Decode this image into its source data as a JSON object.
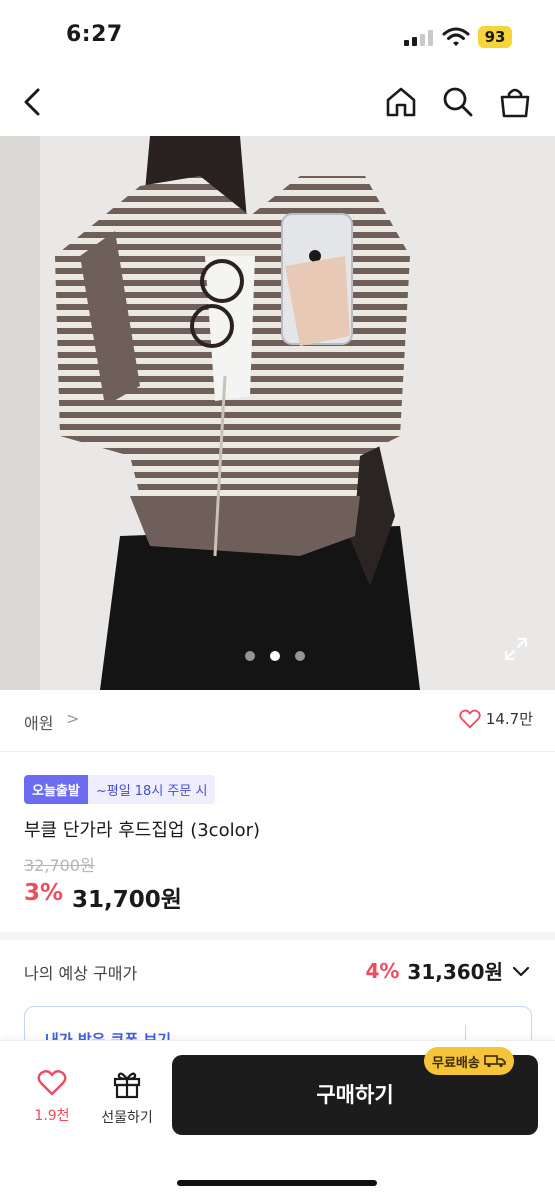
{
  "status_bar": {
    "time": "6:27",
    "battery": "93"
  },
  "nav": {
    "back_icon": "chevron-left-icon",
    "home_icon": "home-icon",
    "search_icon": "search-icon",
    "cart_icon": "shopping-bag-icon"
  },
  "gallery": {
    "image_count": 3,
    "active_index": 1
  },
  "seller": {
    "name": "애원",
    "arrow": ">",
    "like_count": "14.7만"
  },
  "product": {
    "badge_today": "오늘출발",
    "badge_condition": "~평일 18시 주문 시",
    "title": "부클 단가라 후드집업 (3color)",
    "original_price": "32,700원",
    "discount_rate": "3%",
    "sale_price": "31,700원"
  },
  "expected_price": {
    "label": "나의 예상 구매가",
    "rate": "4%",
    "price": "31,360원"
  },
  "coupon": {
    "label": "내가 받은 쿠폰 보기"
  },
  "bottom_bar": {
    "wish_count": "1.9천",
    "gift_label": "선물하기",
    "buy_label": "구매하기",
    "free_shipping_label": "무료배송"
  },
  "colors": {
    "accent_red": "#f04b5f",
    "badge_purple": "#6c6cf2",
    "buy_button": "#1c1c1c",
    "free_ship_yellow": "#f5c43a"
  }
}
